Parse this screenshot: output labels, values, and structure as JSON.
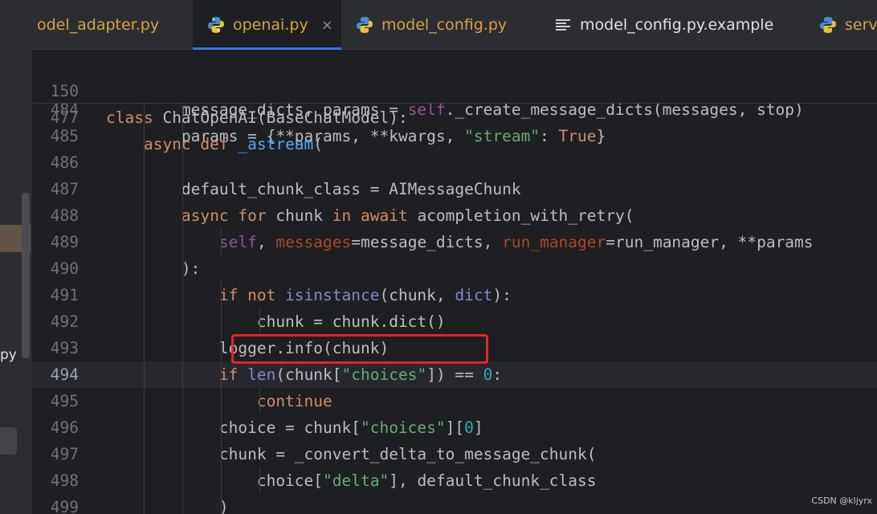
{
  "tabs": [
    {
      "label": "odel_adapter.py",
      "icon": "python-icon",
      "active": false,
      "style": "warn"
    },
    {
      "label": "openai.py",
      "icon": "python-icon",
      "active": true,
      "style": "warn",
      "close": "×"
    },
    {
      "label": "model_config.py",
      "icon": "python-icon",
      "active": false,
      "style": "warn"
    },
    {
      "label": "model_config.py.example",
      "icon": "text-file-icon",
      "active": false,
      "style": "normal"
    },
    {
      "label": "serve",
      "icon": "python-icon",
      "active": false,
      "style": "warn"
    }
  ],
  "left_panel": {
    "truncated_text": "py"
  },
  "sticky_lines": [
    {
      "num": "150",
      "tokens": [
        [
          "kw",
          "class "
        ],
        [
          "pl",
          "ChatOpenAI(BaseChatModel):"
        ]
      ]
    },
    {
      "num": "477",
      "tokens": [
        [
          "kw",
          "    async def "
        ],
        [
          "fn",
          "_astream"
        ],
        [
          "pl",
          "("
        ]
      ]
    }
  ],
  "lines": [
    {
      "num": "484",
      "tokens": [
        [
          "pl",
          "        message_dicts, params = "
        ],
        [
          "self",
          "self"
        ],
        [
          "pl",
          "._create_message_dicts(messages, stop)"
        ]
      ]
    },
    {
      "num": "485",
      "tokens": [
        [
          "pl",
          "        params = {**params, **kwargs, "
        ],
        [
          "st",
          "\"stream\""
        ],
        [
          "pl",
          ": "
        ],
        [
          "kw",
          "True"
        ],
        [
          "pl",
          "}"
        ]
      ]
    },
    {
      "num": "486",
      "tokens": []
    },
    {
      "num": "487",
      "tokens": [
        [
          "pl",
          "        default_chunk_class = AIMessageChunk"
        ]
      ]
    },
    {
      "num": "488",
      "tokens": [
        [
          "kw",
          "        async for "
        ],
        [
          "pl",
          "chunk "
        ],
        [
          "kw",
          "in await "
        ],
        [
          "pl",
          "acompletion_with_retry("
        ]
      ]
    },
    {
      "num": "489",
      "tokens": [
        [
          "pl",
          "            "
        ],
        [
          "self",
          "self"
        ],
        [
          "pl",
          ", "
        ],
        [
          "prm",
          "messages"
        ],
        [
          "pl",
          "=message_dicts, "
        ],
        [
          "prm",
          "run_manager"
        ],
        [
          "pl",
          "=run_manager, **params"
        ]
      ]
    },
    {
      "num": "490",
      "tokens": [
        [
          "pl",
          "        ):"
        ]
      ]
    },
    {
      "num": "491",
      "tokens": [
        [
          "kw",
          "            if not "
        ],
        [
          "bi",
          "isinstance"
        ],
        [
          "pl",
          "(chunk, "
        ],
        [
          "bi",
          "dict"
        ],
        [
          "pl",
          "):"
        ]
      ]
    },
    {
      "num": "492",
      "tokens": [
        [
          "pl",
          "                chunk = chunk.dict()"
        ]
      ]
    },
    {
      "num": "493",
      "tokens": [
        [
          "pl",
          "            logger.info(chunk)"
        ]
      ]
    },
    {
      "num": "494",
      "tokens": [
        [
          "kw",
          "            if "
        ],
        [
          "bi",
          "len"
        ],
        [
          "pl",
          "(chunk["
        ],
        [
          "st",
          "\"choices\""
        ],
        [
          "pl",
          "]) == "
        ],
        [
          "num",
          "0"
        ],
        [
          "pl",
          ":"
        ]
      ],
      "current": true
    },
    {
      "num": "495",
      "tokens": [
        [
          "kw",
          "                continue"
        ]
      ]
    },
    {
      "num": "496",
      "tokens": [
        [
          "pl",
          "            choice = chunk["
        ],
        [
          "st",
          "\"choices\""
        ],
        [
          "pl",
          "]["
        ],
        [
          "num",
          "0"
        ],
        [
          "pl",
          "]"
        ]
      ]
    },
    {
      "num": "497",
      "tokens": [
        [
          "pl",
          "            chunk = _convert_delta_to_message_chunk("
        ]
      ]
    },
    {
      "num": "498",
      "tokens": [
        [
          "pl",
          "                choice["
        ],
        [
          "st",
          "\"delta\""
        ],
        [
          "pl",
          "], default_chunk_class"
        ]
      ]
    },
    {
      "num": "499",
      "tokens": [
        [
          "pl",
          "            )"
        ]
      ]
    }
  ],
  "watermark": "CSDN @kljyrx",
  "colors": {
    "accent": "#3574f0",
    "highlight_box": "#e8222c",
    "warn_tab": "#d9a343"
  }
}
